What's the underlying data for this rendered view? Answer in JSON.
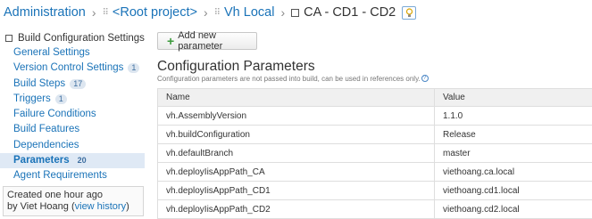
{
  "breadcrumb": {
    "items": [
      "Administration",
      "<Root project>",
      "Vh Local",
      "CA - CD1 - CD2"
    ]
  },
  "sidebar": {
    "title": "Build Configuration Settings",
    "items": [
      {
        "label": "General Settings",
        "badge": ""
      },
      {
        "label": "Version Control Settings",
        "badge": "1"
      },
      {
        "label": "Build Steps",
        "badge": "17"
      },
      {
        "label": "Triggers",
        "badge": "1"
      },
      {
        "label": "Failure Conditions",
        "badge": ""
      },
      {
        "label": "Build Features",
        "badge": ""
      },
      {
        "label": "Dependencies",
        "badge": ""
      },
      {
        "label": "Parameters",
        "badge": "20"
      },
      {
        "label": "Agent Requirements",
        "badge": ""
      }
    ],
    "created": {
      "line1": "Created one hour ago",
      "by": "by Viet Hoang (",
      "link": "view history",
      "close": ")"
    }
  },
  "main": {
    "add_button": "Add new parameter",
    "title": "Configuration Parameters",
    "note": "Configuration parameters are not passed into build, can be used in references only.",
    "help_glyph": "?",
    "columns": [
      "Name",
      "Value"
    ],
    "rows": [
      {
        "name": "vh.AssemblyVersion",
        "value": "1.1.0"
      },
      {
        "name": "vh.buildConfiguration",
        "value": "Release"
      },
      {
        "name": "vh.defaultBranch",
        "value": "master"
      },
      {
        "name": "vh.deployIisAppPath_CA",
        "value": "viethoang.ca.local"
      },
      {
        "name": "vh.deployIisAppPath_CD1",
        "value": "viethoang.cd1.local"
      },
      {
        "name": "vh.deployIisAppPath_CD2",
        "value": "viethoang.cd2.local"
      }
    ]
  },
  "colors": {
    "link": "#1a73b8",
    "active_bg": "#dfe9f5",
    "header_bg": "#f0f0f0"
  },
  "icons": [
    "project-icon",
    "project-icon",
    "build-config-icon",
    "lightbulb-icon",
    "plus-icon",
    "help-icon"
  ]
}
